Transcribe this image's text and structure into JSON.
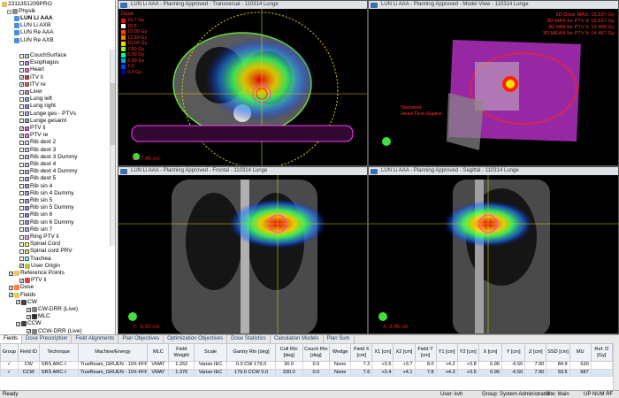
{
  "tree": {
    "patient": "2311351209PRO",
    "course": "Physik",
    "plans": [
      "LUN Li AAA",
      "LUN Li AXB",
      "LUN Re AAA",
      "LUN Re AXB"
    ],
    "structures": [
      {
        "label": "CouchSurface",
        "color": "#a8d8e8",
        "checked": false
      },
      {
        "label": "Esophagus",
        "color": "#c070ff",
        "checked": false
      },
      {
        "label": "Heart",
        "color": "#ff60c0",
        "checked": false
      },
      {
        "label": "ITV li",
        "color": "#ff2020",
        "checked": true
      },
      {
        "label": "ITV re",
        "color": "#ff5050",
        "checked": true
      },
      {
        "label": "Liver",
        "color": "#c080c0",
        "checked": false
      },
      {
        "label": "Lung left",
        "color": "#80a0ff",
        "checked": false
      },
      {
        "label": "Lung right",
        "color": "#8080ff",
        "checked": false
      },
      {
        "label": "Lunge ges - PTVs",
        "color": "#a0a0ff",
        "checked": false
      },
      {
        "label": "Lunge gesamt",
        "color": "#9090d0",
        "checked": false
      },
      {
        "label": "PTV li",
        "color": "#ff40ff",
        "checked": true
      },
      {
        "label": "PTV re",
        "color": "#ff60ff",
        "checked": true
      },
      {
        "label": "Rib dext 2",
        "color": "#d0d0ff",
        "checked": false
      },
      {
        "label": "Rib dext 3",
        "color": "#c0c0ff",
        "checked": false
      },
      {
        "label": "Rib dext 3 Dummy",
        "color": "#b0b0ff",
        "checked": false
      },
      {
        "label": "Rib dext 4",
        "color": "#c0b0ff",
        "checked": false
      },
      {
        "label": "Rib dext 4 Dummy",
        "color": "#b0a0ff",
        "checked": false
      },
      {
        "label": "Rib dext 5",
        "color": "#a0a0ff",
        "checked": false
      },
      {
        "label": "Rib sin 4",
        "color": "#9090ff",
        "checked": false
      },
      {
        "label": "Rib sin 4 Dummy",
        "color": "#a090ff",
        "checked": false
      },
      {
        "label": "Rib sin 5",
        "color": "#b090ff",
        "checked": false
      },
      {
        "label": "Rib sin 5 Dummy",
        "color": "#9080ff",
        "checked": false
      },
      {
        "label": "Rib sin 6",
        "color": "#8070ff",
        "checked": false
      },
      {
        "label": "Rib sin 6 Dummy",
        "color": "#a080ff",
        "checked": false
      },
      {
        "label": "Rib sin 7",
        "color": "#c090ff",
        "checked": false
      },
      {
        "label": "Ring PTV li",
        "color": "#ff90ff",
        "checked": false
      },
      {
        "label": "Spinal Cord",
        "color": "#ffff40",
        "checked": false
      },
      {
        "label": "Spinal cord PRV",
        "color": "#ffd040",
        "checked": false
      },
      {
        "label": "Trachea",
        "color": "#60ffff",
        "checked": false
      }
    ],
    "user_origin": "User Origin",
    "reference_points": "Reference Points",
    "ref_ptv": "PTV li",
    "dose": "Dose",
    "fields_label": "Fields",
    "field_cw": "CW",
    "cw_drr": "CW-DRR (Live)",
    "mlc": "MLC",
    "field_ccw": "CCW",
    "ccw_drr": "CCW-DRR (Live)"
  },
  "views": {
    "transversal": {
      "title": "LUN Li AAA - Planning Approved - Transversal - 110314 Lunge",
      "coord": "Z: -7.49 cm"
    },
    "model": {
      "title": "LUN Li AAA - Planning Approved - Model View - 110314 Lunge",
      "patient_orient": "Standard\nHead First-Supine"
    },
    "frontal": {
      "title": "LUN Li AAA - Planning Approved - Frontal - 110314 Lunge",
      "coord": "Y: -6.50 cm"
    },
    "sagittal": {
      "title": "LUN Li AAA - Planning Approved - Sagittal - 110314 Lunge",
      "coord": "X: 6.96 cm"
    }
  },
  "dose_legend": {
    "title": "Dose",
    "levels": [
      {
        "label": "15.7 Gy",
        "color": "#ff0000"
      },
      {
        "label": "15.5",
        "color": "#ffffff"
      },
      {
        "label": "15.00 Gy",
        "color": "#ff4000"
      },
      {
        "label": "12.50 Gy",
        "color": "#ff8000"
      },
      {
        "label": "10.00 Gy",
        "color": "#ffd000"
      },
      {
        "label": "7.50 Gy",
        "color": "#80ff00"
      },
      {
        "label": "5.00 Gy",
        "color": "#00ff80"
      },
      {
        "label": "2.50 Gy",
        "color": "#00a0ff"
      },
      {
        "label": "1.0",
        "color": "#0040ff"
      },
      {
        "label": "0.0 Gy",
        "color": "#0000a0"
      }
    ]
  },
  "model_stats": [
    "3D Dose MAX: 15.537 Gy",
    "3D MAX for PTV li: 15.537 Gy",
    "3D MIN for PTV li: 13.466 Gy",
    "3D MEAN for PTV li: 14.467 Gy"
  ],
  "tabs": [
    "Fields",
    "Dose Prescription",
    "Field Alignments",
    "Plan Objectives",
    "Optimization Objectives",
    "Dose Statistics",
    "Calculation Models",
    "Plan Sum"
  ],
  "grid": {
    "headers": [
      "Group",
      "Field ID",
      "Technique",
      "Machine/Energy",
      "MLC",
      "Field Weight",
      "Scale",
      "Gantry Rtn [deg]",
      "Coll Rtn [deg]",
      "Couch Rtn [deg]",
      "Wedge",
      "Field X [cm]",
      "X1 [cm]",
      "X2 [cm]",
      "Field Y [cm]",
      "Y1 [cm]",
      "Y2 [cm]",
      "X [cm]",
      "Y [cm]",
      "Z [cm]",
      "SSD [cm]",
      "MU",
      "Ref. D [Gy]"
    ],
    "rows": [
      [
        "✓",
        "CW",
        "SRS ARC-I",
        "TrueBeam_GRUEN - 10X-FFF",
        "VMAT",
        "1.262",
        "Varian IEC",
        "0.0 CW 179.0",
        "30.0",
        "0.0",
        "None",
        "7.2",
        "+3.5",
        "+3.7",
        "8.0",
        "+4.2",
        "+3.8",
        "6.96",
        "-6.50",
        "7.90",
        "84.9",
        "630",
        ""
      ],
      [
        "✓",
        "CCW",
        "SRS ARC-I",
        "TrueBeam_GRUEN - 10X-FFF",
        "VMAT",
        "1.376",
        "Varian IEC",
        "179.0 CCW 0.0",
        "330.0",
        "0.0",
        "None",
        "7.6",
        "+3.4",
        "+4.1",
        "7.8",
        "+4.3",
        "+3.5",
        "6.96",
        "-6.50",
        "7.90",
        "93.5",
        "687",
        ""
      ]
    ]
  },
  "status": {
    "ready": "Ready",
    "user": "User: kvh",
    "group": "Group: System Administrator",
    "site": "Site: Main",
    "modes": "UP NUM RF"
  }
}
